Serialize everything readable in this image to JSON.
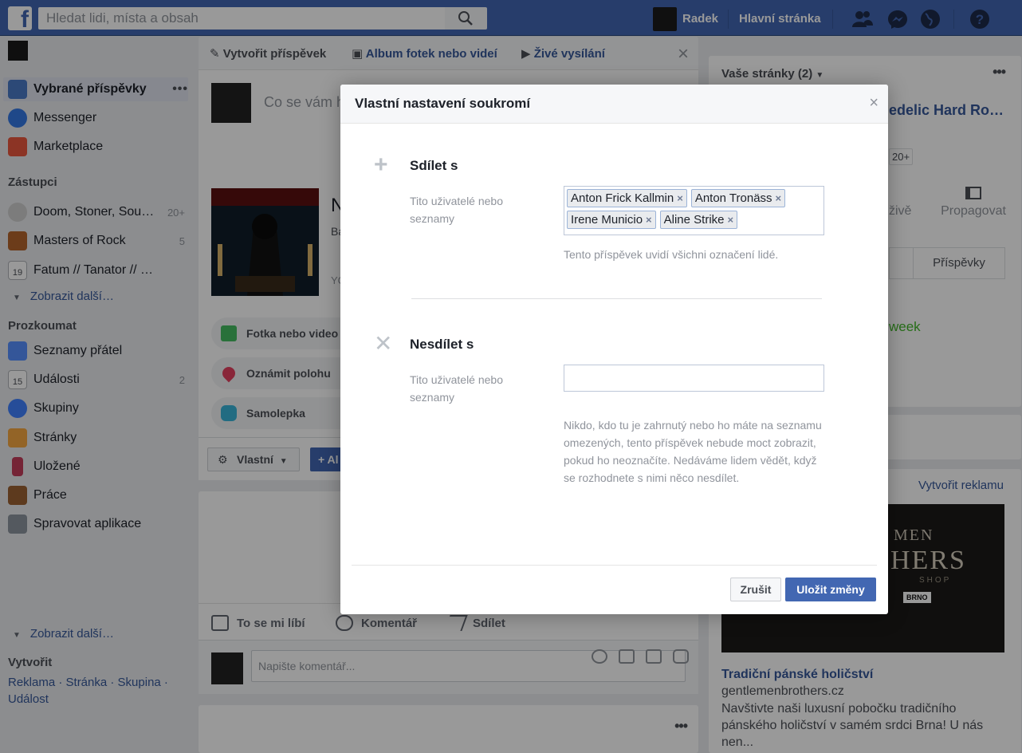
{
  "topbar": {
    "logo": "f",
    "search_placeholder": "Hledat lidi, místa a obsah",
    "user_name": "Radek",
    "home_label": "Hlavní stránka"
  },
  "sidebar": {
    "items": [
      {
        "label": "Vybrané příspěvky",
        "count": "",
        "icon": "news-feed-icon"
      },
      {
        "label": "Messenger",
        "count": "",
        "icon": "messenger-icon"
      },
      {
        "label": "Marketplace",
        "count": "",
        "icon": "marketplace-icon"
      }
    ],
    "shortcuts_heading": "Zástupci",
    "shortcuts": [
      {
        "label": "Doom, Stoner, Sou…",
        "count": "20+"
      },
      {
        "label": "Masters of Rock",
        "count": "5"
      },
      {
        "label": "Fatum // Tanator // …",
        "count": ""
      }
    ],
    "more_label": "Zobrazit další…",
    "explore_heading": "Prozkoumat",
    "explore": [
      {
        "label": "Seznamy přátel",
        "count": ""
      },
      {
        "label": "Události",
        "count": "2"
      },
      {
        "label": "Skupiny",
        "count": ""
      },
      {
        "label": "Stránky",
        "count": ""
      },
      {
        "label": "Uložené",
        "count": ""
      },
      {
        "label": "Práce",
        "count": ""
      },
      {
        "label": "Spravovat aplikace",
        "count": ""
      }
    ],
    "more_label_2": "Zobrazit další…",
    "create_heading": "Vytvořit",
    "create_links": "Reklama · Stránka · Skupina · Událost"
  },
  "composer": {
    "tab_post": "Vytvořit příspěvek",
    "tab_album": "Album fotek nebo videí",
    "tab_live": "Živé vysílání",
    "placeholder": "Co se vám h",
    "album_title": "N",
    "album_sub": "Ba",
    "album_yo": "YO",
    "options": [
      "Fotka nebo video",
      "Oznámit polohu",
      "Samolepka"
    ],
    "privacy_label": "Vlastní",
    "add_label": "+ Al"
  },
  "post": {
    "like": "To se mi líbí",
    "comment": "Komentář",
    "share": "Sdílet",
    "comment_placeholder": "Napište komentář..."
  },
  "right": {
    "pages_heading": "Vaše stránky (2)",
    "page_name": "edelic Hard Ro…",
    "badge": "20+",
    "live": "živě",
    "promote": "Propagovat",
    "tab_posts": "Příspěvky",
    "week": "week",
    "create_ad": "Vytvořit reklamu",
    "ad_img_t1": "MEN",
    "ad_img_t2": "HERS",
    "ad_img_t3": "SHOP",
    "ad_img_t4": "BRNO",
    "ad_title": "Tradiční pánské holičství",
    "ad_domain": "gentlemenbrothers.cz",
    "ad_desc": "Navštivte naši luxusní pobočku tradičního pánského holičství v samém srdci Brna! U nás nen..."
  },
  "modal": {
    "title": "Vlastní nastavení soukromí",
    "share_title": "Sdílet s",
    "share_label": "Tito uživatelé nebo seznamy",
    "tokens": [
      "Anton Frick Kallmin",
      "Anton Tronäss",
      "Irene Municio",
      "Aline Strike"
    ],
    "share_hint": "Tento příspěvek uvidí všichni označení lidé.",
    "noshare_title": "Nesdílet s",
    "noshare_label": "Tito uživatelé nebo seznamy",
    "noshare_desc": "Nikdo, kdo tu je zahrnutý nebo ho máte na seznamu omezených, tento příspěvek nebude moct zobrazit, pokud ho neoznačíte. Nedáváme lidem vědět, když se rozhodnete s nimi něco nesdílet.",
    "cancel": "Zrušit",
    "save": "Uložit změny"
  }
}
